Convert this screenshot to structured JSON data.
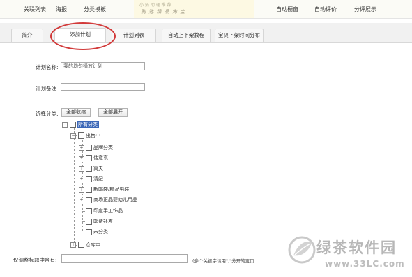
{
  "topnav": {
    "items": [
      "关联列表",
      "海报",
      "分类模板",
      "自动橱窗",
      "自动评价",
      "分评展示"
    ],
    "banner_line1": "小 拓 助 理 推 荐",
    "banner_line2": "刷 选 精 品 淘 宝"
  },
  "tabs": [
    "简介",
    "添加计划",
    "计划列表",
    "自动上下架教程",
    "宝贝下架时间分布"
  ],
  "form": {
    "plan_name_label": "计划名称:",
    "plan_name_value": "我的均匀播放计划",
    "plan_note_label": "计划备注:",
    "plan_note_value": "",
    "category_label": "选择分类:",
    "collapse_all": "全部收缩",
    "expand_all": "全部展开"
  },
  "tree": {
    "root": "所有分类",
    "on_sale": "出售中",
    "children": [
      "品牌分类",
      "估意衰",
      "寓夫",
      "清妃",
      "新邮袋/精品男装",
      "商场正品婴幼儿用品",
      "印度手工饰品",
      "邮费补差",
      "未分类"
    ],
    "warehouse": "仓库中"
  },
  "keyword_filter": {
    "label": "仅调整标题中含有:",
    "value": "",
    "hint": "(多个关键字请用\",\"分开的宝贝"
  },
  "watermark": {
    "text": "绿茶软件园",
    "url": "www.33LC.com"
  },
  "colors": {
    "annotation": "#d23a3a",
    "selected": "#3b67b7"
  }
}
